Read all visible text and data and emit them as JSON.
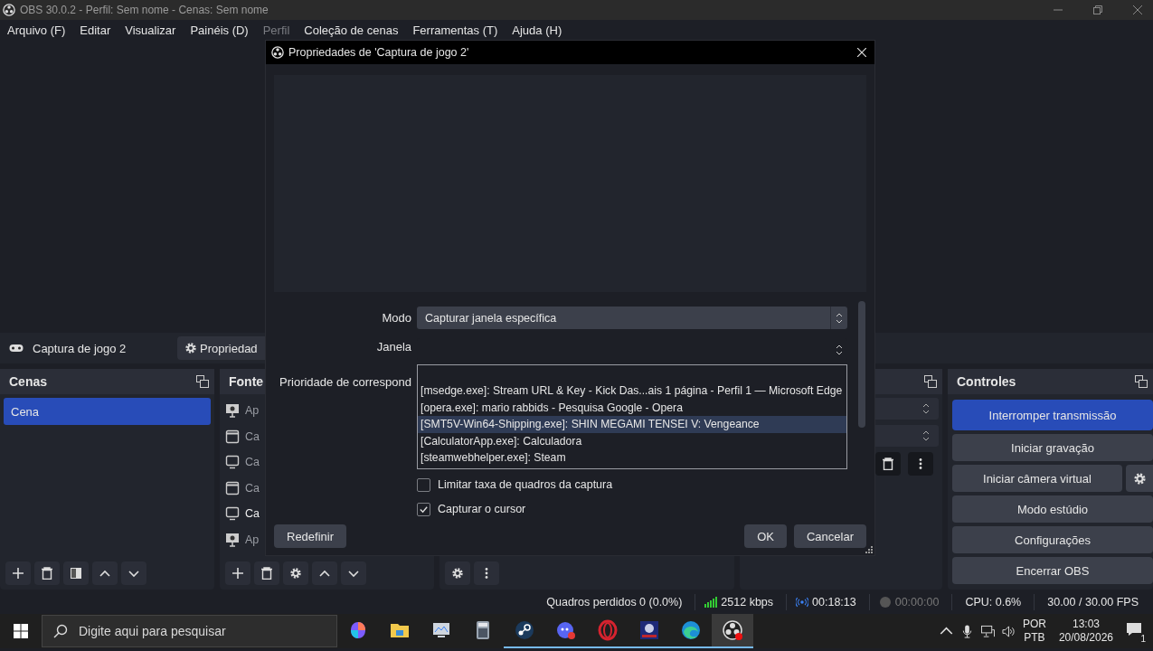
{
  "window": {
    "title": "OBS 30.0.2 - Perfil: Sem nome - Cenas: Sem nome"
  },
  "menu": [
    {
      "label": "Arquivo (F)",
      "disabled": false
    },
    {
      "label": "Editar",
      "disabled": false
    },
    {
      "label": "Visualizar",
      "disabled": false
    },
    {
      "label": "Painéis (D)",
      "disabled": false
    },
    {
      "label": "Perfil",
      "disabled": true
    },
    {
      "label": "Coleção de cenas",
      "disabled": false
    },
    {
      "label": "Ferramentas (T)",
      "disabled": false
    },
    {
      "label": "Ajuda (H)",
      "disabled": false
    }
  ],
  "source_toolbar": {
    "source_name": "Captura de jogo 2",
    "properties_button": "Propriedad"
  },
  "scenes": {
    "title": "Cenas",
    "items": [
      {
        "label": "Cena",
        "selected": true
      }
    ]
  },
  "sources": {
    "title": "Fonte",
    "items": [
      {
        "label": "Ap",
        "kind": "slideshow",
        "visible": false
      },
      {
        "label": "Ca",
        "kind": "window",
        "visible": false
      },
      {
        "label": "Ca",
        "kind": "display",
        "visible": false
      },
      {
        "label": "Ca",
        "kind": "window",
        "visible": false
      },
      {
        "label": "Ca",
        "kind": "display",
        "visible": true
      },
      {
        "label": "Ap",
        "kind": "slideshow",
        "visible": false
      }
    ]
  },
  "controls": {
    "title": "Controles",
    "buttons": [
      {
        "label": "Interromper transmissão",
        "active": true,
        "has_settings": false
      },
      {
        "label": "Iniciar gravação",
        "active": false,
        "has_settings": false
      },
      {
        "label": "Iniciar câmera virtual",
        "active": false,
        "has_settings": true
      },
      {
        "label": "Modo estúdio",
        "active": false,
        "has_settings": false
      },
      {
        "label": "Configurações",
        "active": false,
        "has_settings": false
      },
      {
        "label": "Encerrar OBS",
        "active": false,
        "has_settings": false
      }
    ]
  },
  "status_bar": {
    "dropped_frames": "Quadros perdidos 0 (0.0%)",
    "bitrate": "2512 kbps",
    "stream_time": "00:18:13",
    "streaming": true,
    "record_time": "00:00:00",
    "recording": false,
    "cpu": "CPU: 0.6%",
    "fps": "30.00 / 30.00 FPS"
  },
  "dialog": {
    "title": "Propriedades de 'Captura de jogo 2'",
    "mode_label": "Modo",
    "mode_value": "Capturar janela específica",
    "window_label": "Janela",
    "priority_label": "Prioridade de correspond",
    "window_options": [
      {
        "label": "[msedge.exe]: Stream URL & Key - Kick Das...ais 1 página - Perfil 1 — Microsoft Edge",
        "selected": false
      },
      {
        "label": "[opera.exe]: mario rabbids - Pesquisa Google - Opera",
        "selected": false
      },
      {
        "label": "[SMT5V-Win64-Shipping.exe]: SHIN MEGAMI TENSEI V: Vengeance",
        "selected": true
      },
      {
        "label": "[CalculatorApp.exe]: Calculadora",
        "selected": false
      },
      {
        "label": "[steamwebhelper.exe]: Steam",
        "selected": false
      }
    ],
    "checkboxes": [
      {
        "label": "Limitar taxa de quadros da captura",
        "checked": false
      },
      {
        "label": "Capturar o cursor",
        "checked": true
      }
    ],
    "reset_button": "Redefinir",
    "ok_button": "OK",
    "cancel_button": "Cancelar"
  },
  "taskbar": {
    "search_placeholder": "Digite aqui para pesquisar",
    "apps": [
      {
        "kind": "copilot",
        "running": false,
        "selected": false
      },
      {
        "kind": "folder",
        "running": false,
        "selected": false
      },
      {
        "kind": "monitor",
        "running": false,
        "selected": false
      },
      {
        "kind": "calculator",
        "running": false,
        "selected": false
      },
      {
        "kind": "steam",
        "running": true,
        "selected": false
      },
      {
        "kind": "chat",
        "running": true,
        "selected": false
      },
      {
        "kind": "opera",
        "running": true,
        "selected": false
      },
      {
        "kind": "game",
        "running": true,
        "selected": false
      },
      {
        "kind": "edge",
        "running": true,
        "selected": false
      },
      {
        "kind": "obs",
        "running": true,
        "selected": true
      }
    ],
    "language": "POR",
    "keyboard": "PTB",
    "time": "13:03",
    "date": "20/08/2026",
    "notifications": "1"
  }
}
